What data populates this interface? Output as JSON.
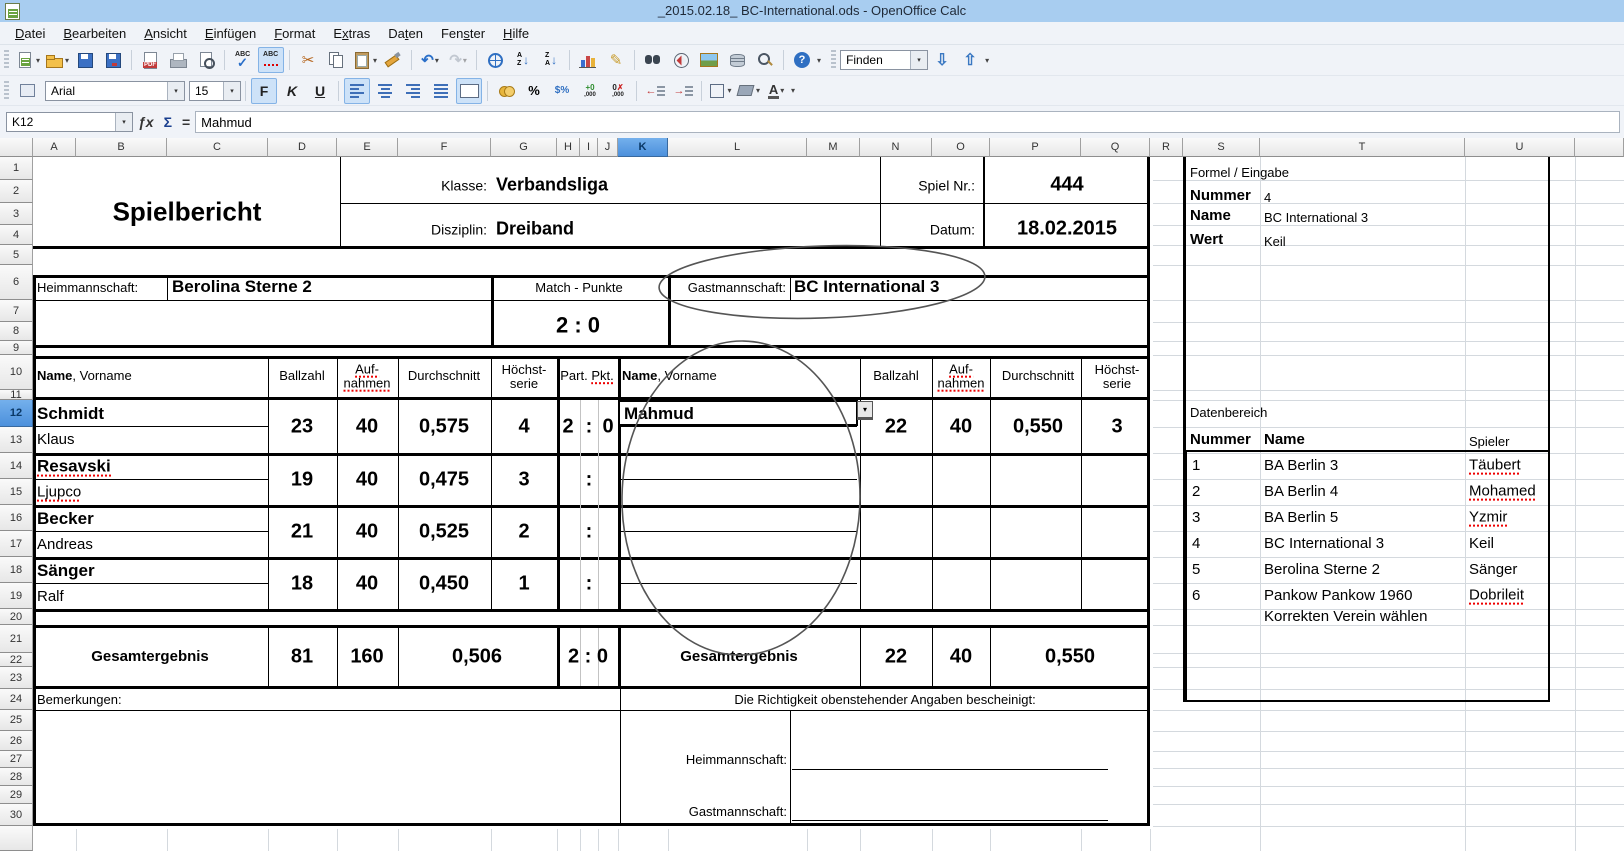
{
  "window": {
    "title": "_2015.02.18_ BC-International.ods - OpenOffice Calc"
  },
  "menu": {
    "items": [
      {
        "label": "Datei",
        "u": 0
      },
      {
        "label": "Bearbeiten",
        "u": 0
      },
      {
        "label": "Ansicht",
        "u": 0
      },
      {
        "label": "Einfügen",
        "u": 0
      },
      {
        "label": "Format",
        "u": 0
      },
      {
        "label": "Extras",
        "u": 1
      },
      {
        "label": "Daten",
        "u": 2
      },
      {
        "label": "Fenster",
        "u": 3
      },
      {
        "label": "Hilfe",
        "u": 0
      }
    ]
  },
  "icons": {
    "caret": "▾",
    "cut": "✂",
    "undo": "↶",
    "redo": "↷",
    "pencil": "✎",
    "find_down": "⇩",
    "find_up": "⇧",
    "help": "?",
    "abc": "ABC",
    "pdf": "PDF",
    "sort_a": "A",
    "sort_z": "Z",
    "sort_arrow": "↓",
    "percent": "%",
    "dollar_percent": "$%",
    "plus_zero": "+0",
    "zero": "0",
    "zeros": ",000",
    "del_x": "✗",
    "indent_left": "←",
    "indent_right": "→",
    "font_a": "A",
    "sum": "Σ",
    "equals": "=",
    "fx": "ƒx",
    "check": "✓"
  },
  "toolbar": {
    "find_value": "Finden"
  },
  "format": {
    "font": "Arial",
    "size": "15",
    "b": "F",
    "i": "K",
    "u": "U"
  },
  "formula_bar": {
    "cell_ref": "K12",
    "content": "Mahmud"
  },
  "grid": {
    "columns": [
      "A",
      "B",
      "C",
      "D",
      "E",
      "F",
      "G",
      "H",
      "I",
      "J",
      "K",
      "L",
      "M",
      "N",
      "O",
      "P",
      "Q",
      "R",
      "S",
      "T",
      "U"
    ],
    "rows": [
      "1",
      "2",
      "3",
      "4",
      "5",
      "6",
      "7",
      "8",
      "9",
      "10",
      "11",
      "12",
      "13",
      "14",
      "15",
      "16",
      "17",
      "18",
      "19",
      "20",
      "21",
      "22",
      "23",
      "24",
      "25",
      "26",
      "27",
      "28",
      "29",
      "30",
      ""
    ],
    "selected_cell": "K12",
    "selected_column": "K",
    "selected_row": "12"
  },
  "report": {
    "title": "Spielbericht",
    "klasse_label": "Klasse:",
    "klasse": "Verbandsliga",
    "disziplin_label": "Disziplin:",
    "disziplin": "Dreiband",
    "spielnr_label": "Spiel Nr.:",
    "spielnr": "444",
    "datum_label": "Datum:",
    "datum": "18.02.2015",
    "heim_label": "Heimmannschaft:",
    "heim": "Berolina Sterne 2",
    "match_label": "Match - Punkte",
    "match_score": "2 : 0",
    "gast_label": "Gastmannschaft:",
    "gast": "BC International 3",
    "th": {
      "name": "Name",
      "vorname": ", Vorname",
      "ballzahl": "Ballzahl",
      "auf": "Auf-",
      "nahmen": "nahmen",
      "durchschnitt": "Durchschnitt",
      "hoechst": "Höchst-",
      "serie": "serie",
      "part": "Part.",
      "pkt": "Pkt."
    },
    "home_players": [
      {
        "surname": "Schmidt",
        "firstname": "Klaus",
        "sq_surname": false,
        "sq_firstname": false,
        "ballzahl": "23",
        "aufnahmen": "40",
        "durchschnitt": "0,575",
        "hoechstserie": "4",
        "part": "2",
        "colon": ":",
        "pkt": "0"
      },
      {
        "surname": "Resavski",
        "firstname": "Ljupco",
        "sq_surname": true,
        "sq_firstname": true,
        "ballzahl": "19",
        "aufnahmen": "40",
        "durchschnitt": "0,475",
        "hoechstserie": "3",
        "part": "",
        "colon": ":",
        "pkt": ""
      },
      {
        "surname": "Becker",
        "firstname": "Andreas",
        "sq_surname": false,
        "sq_firstname": false,
        "ballzahl": "21",
        "aufnahmen": "40",
        "durchschnitt": "0,525",
        "hoechstserie": "2",
        "part": "",
        "colon": ":",
        "pkt": ""
      },
      {
        "surname": "Sänger",
        "firstname": "Ralf",
        "sq_surname": false,
        "sq_firstname": false,
        "ballzahl": "18",
        "aufnahmen": "40",
        "durchschnitt": "0,450",
        "hoechstserie": "1",
        "part": "",
        "colon": ":",
        "pkt": ""
      }
    ],
    "guest_players": [
      {
        "name": "Mahmud",
        "ballzahl": "22",
        "aufnahmen": "40",
        "durchschnitt": "0,550",
        "hoechstserie": "3"
      }
    ],
    "gesamt": {
      "label": "Gesamtergebnis",
      "home": {
        "ballzahl": "81",
        "aufnahmen": "160",
        "durchschnitt": "0,506",
        "score": "2 : 0"
      },
      "guest": {
        "ballzahl": "22",
        "aufnahmen": "40",
        "durchschnitt": "0,550"
      }
    },
    "bemerkungen_label": "Bemerkungen:",
    "richtigkeit": "Die Richtigkeit obenstehender Angaben bescheinigt:",
    "heim_sig_label": "Heimmannschaft:",
    "gast_sig_label": "Gastmannschaft:"
  },
  "side_panel": {
    "formel_header": "Formel / Eingabe",
    "fields": [
      {
        "label": "Nummer",
        "value": "4"
      },
      {
        "label": "Name",
        "value": "BC International 3"
      },
      {
        "label": "Wert",
        "value": "Keil"
      }
    ],
    "datenbereich": {
      "header": "Datenbereich",
      "col_nummer": "Nummer",
      "col_name": "Name",
      "col_spieler": "Spieler",
      "rows": [
        {
          "nummer": "1",
          "name": "BA Berlin 3",
          "spieler": "Täubert",
          "sq": true
        },
        {
          "nummer": "2",
          "name": "BA Berlin 4",
          "spieler": "Mohamed",
          "sq": true
        },
        {
          "nummer": "3",
          "name": "BA Berlin 5",
          "spieler": "Yzmir",
          "sq": true
        },
        {
          "nummer": "4",
          "name": "BC International 3",
          "spieler": "Keil",
          "sq": false
        },
        {
          "nummer": "5",
          "name": "Berolina Sterne 2",
          "spieler": "Sänger",
          "sq": false
        },
        {
          "nummer": "6",
          "name": "Pankow Pankow 1960",
          "spieler": "Dobrileit",
          "sq": true
        }
      ],
      "note": "Korrekten Verein wählen"
    }
  }
}
